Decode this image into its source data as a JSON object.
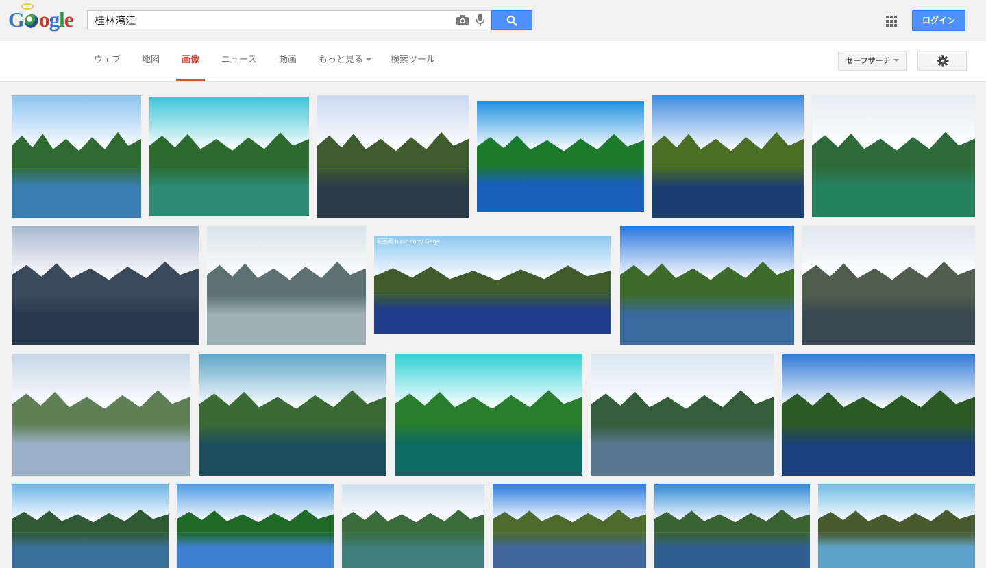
{
  "header": {
    "logo_text": "Google",
    "search_query": "桂林漓江",
    "login_label": "ログイン"
  },
  "nav": {
    "tabs": [
      {
        "label": "ウェブ",
        "active": false
      },
      {
        "label": "地図",
        "active": false
      },
      {
        "label": "画像",
        "active": true
      },
      {
        "label": "ニュース",
        "active": false
      },
      {
        "label": "動画",
        "active": false
      },
      {
        "label": "もっと見る",
        "active": false,
        "dropdown": true
      },
      {
        "label": "検索ツール",
        "active": false
      }
    ],
    "safesearch_label": "セーフサーチ"
  },
  "colors": {
    "accent_blue": "#4d90fe",
    "active_tab_red": "#dd4b39"
  },
  "results": [
    {
      "palette": [
        "#8dc3ee",
        "#2f6a33",
        "#3a7fb4"
      ]
    },
    {
      "palette": [
        "#3cc4d6",
        "#2d6a2e",
        "#2a8a72"
      ]
    },
    {
      "palette": [
        "#c9d9ef",
        "#3d5b2c",
        "#2d3a48"
      ]
    },
    {
      "palette": [
        "#1f8fe0",
        "#1c7a2c",
        "#1a5fb8"
      ]
    },
    {
      "palette": [
        "#3d8ae0",
        "#4b6e25",
        "#1c3d70"
      ]
    },
    {
      "palette": [
        "#e7eef2",
        "#2f6b3a",
        "#25805f"
      ]
    },
    {
      "palette": [
        "#a9b8cf",
        "#3b4a5a",
        "#2a3950"
      ]
    },
    {
      "palette": [
        "#d8e3e6",
        "#5b7271",
        "#9db0b4"
      ]
    },
    {
      "palette": [
        "#8cc7ef",
        "#3f5c2a",
        "#1e3c88"
      ],
      "watermark": "昵图网 nipic.com/ Gaga"
    },
    {
      "palette": [
        "#2b76e0",
        "#3d6b2a",
        "#3a6a9e"
      ]
    },
    {
      "palette": [
        "#dfe7ee",
        "#4f5d4d",
        "#3a4852"
      ]
    },
    {
      "palette": [
        "#c6d6e6",
        "#5f7f56",
        "#9cb1c7"
      ]
    },
    {
      "palette": [
        "#5ca6c6",
        "#3b6b34",
        "#1d4f5e"
      ]
    },
    {
      "palette": [
        "#2ed0d3",
        "#2a7d2d",
        "#0b6b63"
      ]
    },
    {
      "palette": [
        "#d8e6f2",
        "#345d3a",
        "#5a7890"
      ]
    },
    {
      "palette": [
        "#2f78d6",
        "#2c5a25",
        "#1b3f7a"
      ]
    },
    {
      "palette": [
        "#6fb4e6",
        "#2f5a33",
        "#3c6f97"
      ]
    },
    {
      "palette": [
        "#4d9be4",
        "#1f6a26",
        "#3d7fd0"
      ]
    },
    {
      "palette": [
        "#cfe0f0",
        "#3a6b3c",
        "#3f7e7a"
      ]
    },
    {
      "palette": [
        "#2c7de0",
        "#4c6a2c",
        "#40659a"
      ]
    },
    {
      "palette": [
        "#2f8ad8",
        "#3a6232",
        "#2e5f8e"
      ]
    },
    {
      "palette": [
        "#73bde4",
        "#4a5a2f",
        "#5ea2c8"
      ]
    }
  ]
}
